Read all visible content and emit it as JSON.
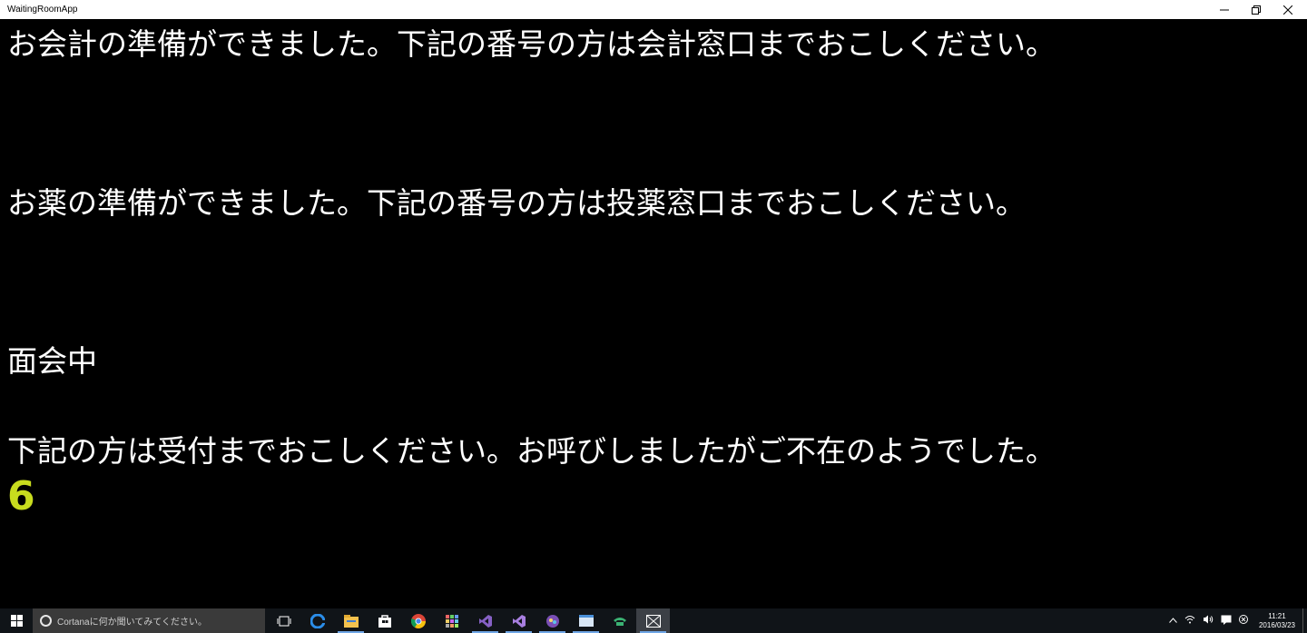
{
  "window": {
    "title": "WaitingRoomApp"
  },
  "messages": {
    "cashier": "お会計の準備ができました。下記の番号の方は会計窓口までおこしください。",
    "pharmacy": "お薬の準備ができました。下記の番号の方は投薬窓口までおこしください。",
    "visiting": "面会中",
    "reception": "下記の方は受付までおこしください。お呼びしましたがご不在のようでした。",
    "reception_number": "6"
  },
  "colors": {
    "background": "#000000",
    "text": "#ffffff",
    "number": "#c8dc1e"
  },
  "taskbar": {
    "search_placeholder": "Cortanaに何か聞いてみてください。",
    "clock_time": "11:21",
    "clock_date": "2016/03/23",
    "icons": [
      "task-view-icon",
      "edge-icon",
      "file-explorer-icon",
      "store-icon",
      "chrome-icon",
      "app-grid-icon",
      "visual-studio-icon",
      "visual-studio-preview-icon",
      "game-icon",
      "window-icon",
      "phone-icon",
      "waitingroom-app-icon"
    ]
  }
}
